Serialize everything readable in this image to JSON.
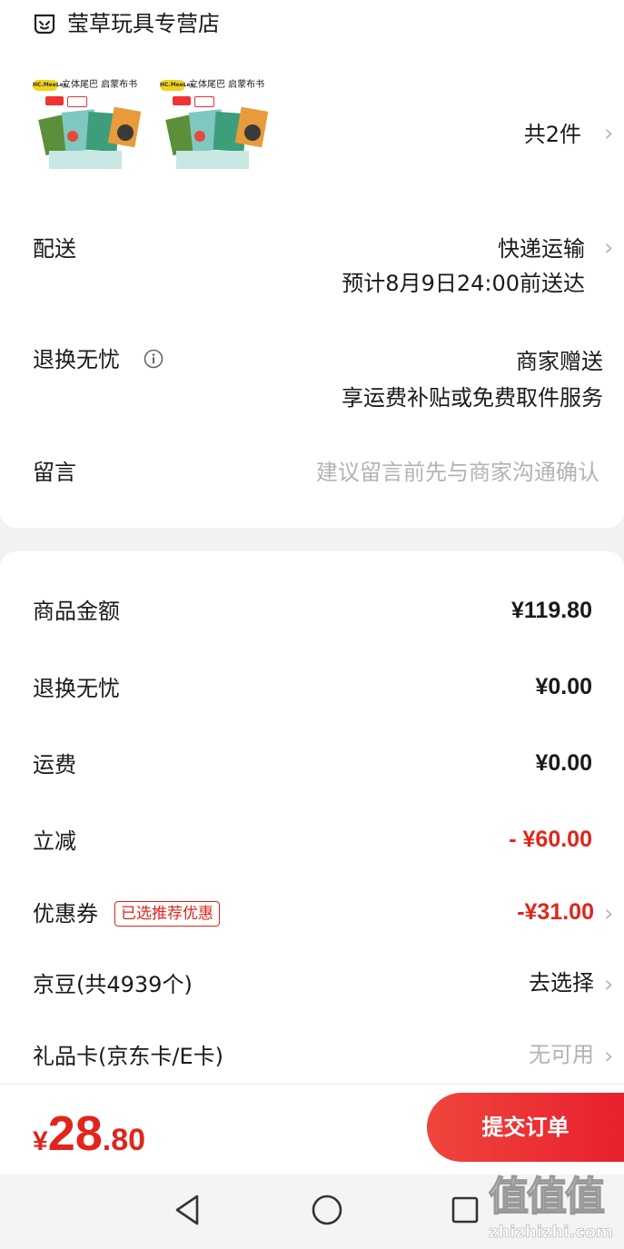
{
  "store": {
    "name": "莹草玩具专营店"
  },
  "products": {
    "thumb_title": "立体尾巴 启蒙布书",
    "brand": "HC.MeeLee",
    "count_label": "共2件"
  },
  "delivery": {
    "label": "配送",
    "method": "快递运输",
    "eta": "预计8月9日24:00前送达"
  },
  "returns": {
    "label": "退换无忧",
    "value": "商家赠送",
    "desc": "享运费补贴或免费取件服务"
  },
  "message": {
    "label": "留言",
    "placeholder": "建议留言前先与商家沟通确认"
  },
  "summary": {
    "goods_label": "商品金额",
    "goods_value": "¥119.80",
    "returns_label": "退换无忧",
    "returns_value": "¥0.00",
    "shipping_label": "运费",
    "shipping_value": "¥0.00",
    "discount_label": "立减",
    "discount_value": "- ¥60.00",
    "coupon_label": "优惠券",
    "coupon_tag": "已选推荐优惠",
    "coupon_value": "-¥31.00",
    "beans_label": "京豆(共4939个)",
    "beans_value": "去选择",
    "giftcard_label": "礼品卡(京东卡/E卡)",
    "giftcard_value": "无可用"
  },
  "checkout": {
    "currency": "¥",
    "total_int": "28",
    "total_dec": ".80",
    "submit_label": "提交订单"
  },
  "watermark": {
    "text": "zhizhizhi.com",
    "glyphs": "值值值"
  },
  "colors": {
    "accent": "#e1251b",
    "button": "#e8202e",
    "muted": "#b3b3b3"
  }
}
